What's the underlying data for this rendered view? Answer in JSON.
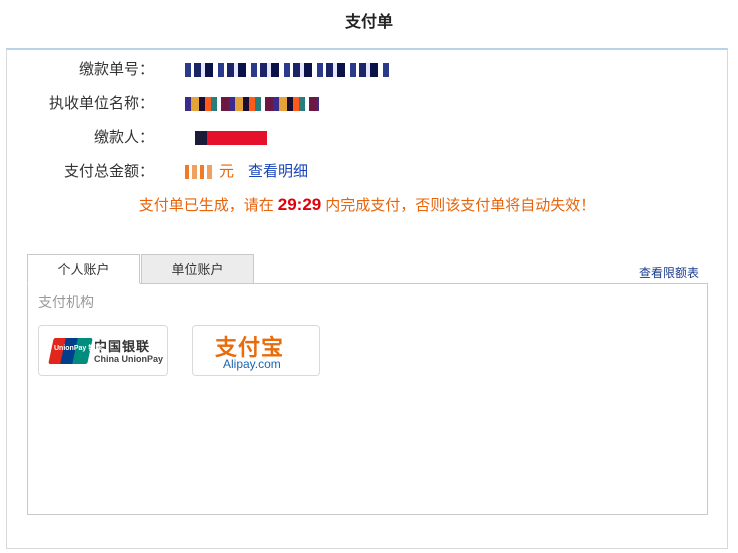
{
  "page": {
    "title": "支付单"
  },
  "info": {
    "bill_no_label": "缴款单号：",
    "agency_label": "执收单位名称：",
    "payer_label": "缴款人：",
    "amount_label": "支付总金额：",
    "amount_unit": "元",
    "detail_link": "查看明细"
  },
  "notice": {
    "prefix": "支付单已生成，请在",
    "timer": "29:29",
    "suffix": "内完成支付，否则该支付单将自动失效！"
  },
  "tabs": [
    {
      "label": "个人账户",
      "active": true
    },
    {
      "label": "单位账户",
      "active": false
    }
  ],
  "limit_link": "查看限额表",
  "panel": {
    "section_label": "支付机构",
    "methods": [
      {
        "name_cn": "中国银联",
        "name_en": "China UnionPay",
        "badge": "UnionPay 银联",
        "icon": "unionpay-logo"
      },
      {
        "name_cn": "支付宝",
        "name_en": "Alipay.com",
        "icon": "alipay-logo"
      }
    ]
  },
  "colors": {
    "accent": "#e8630a",
    "timer": "#e0000a",
    "link": "#1a44b8"
  }
}
